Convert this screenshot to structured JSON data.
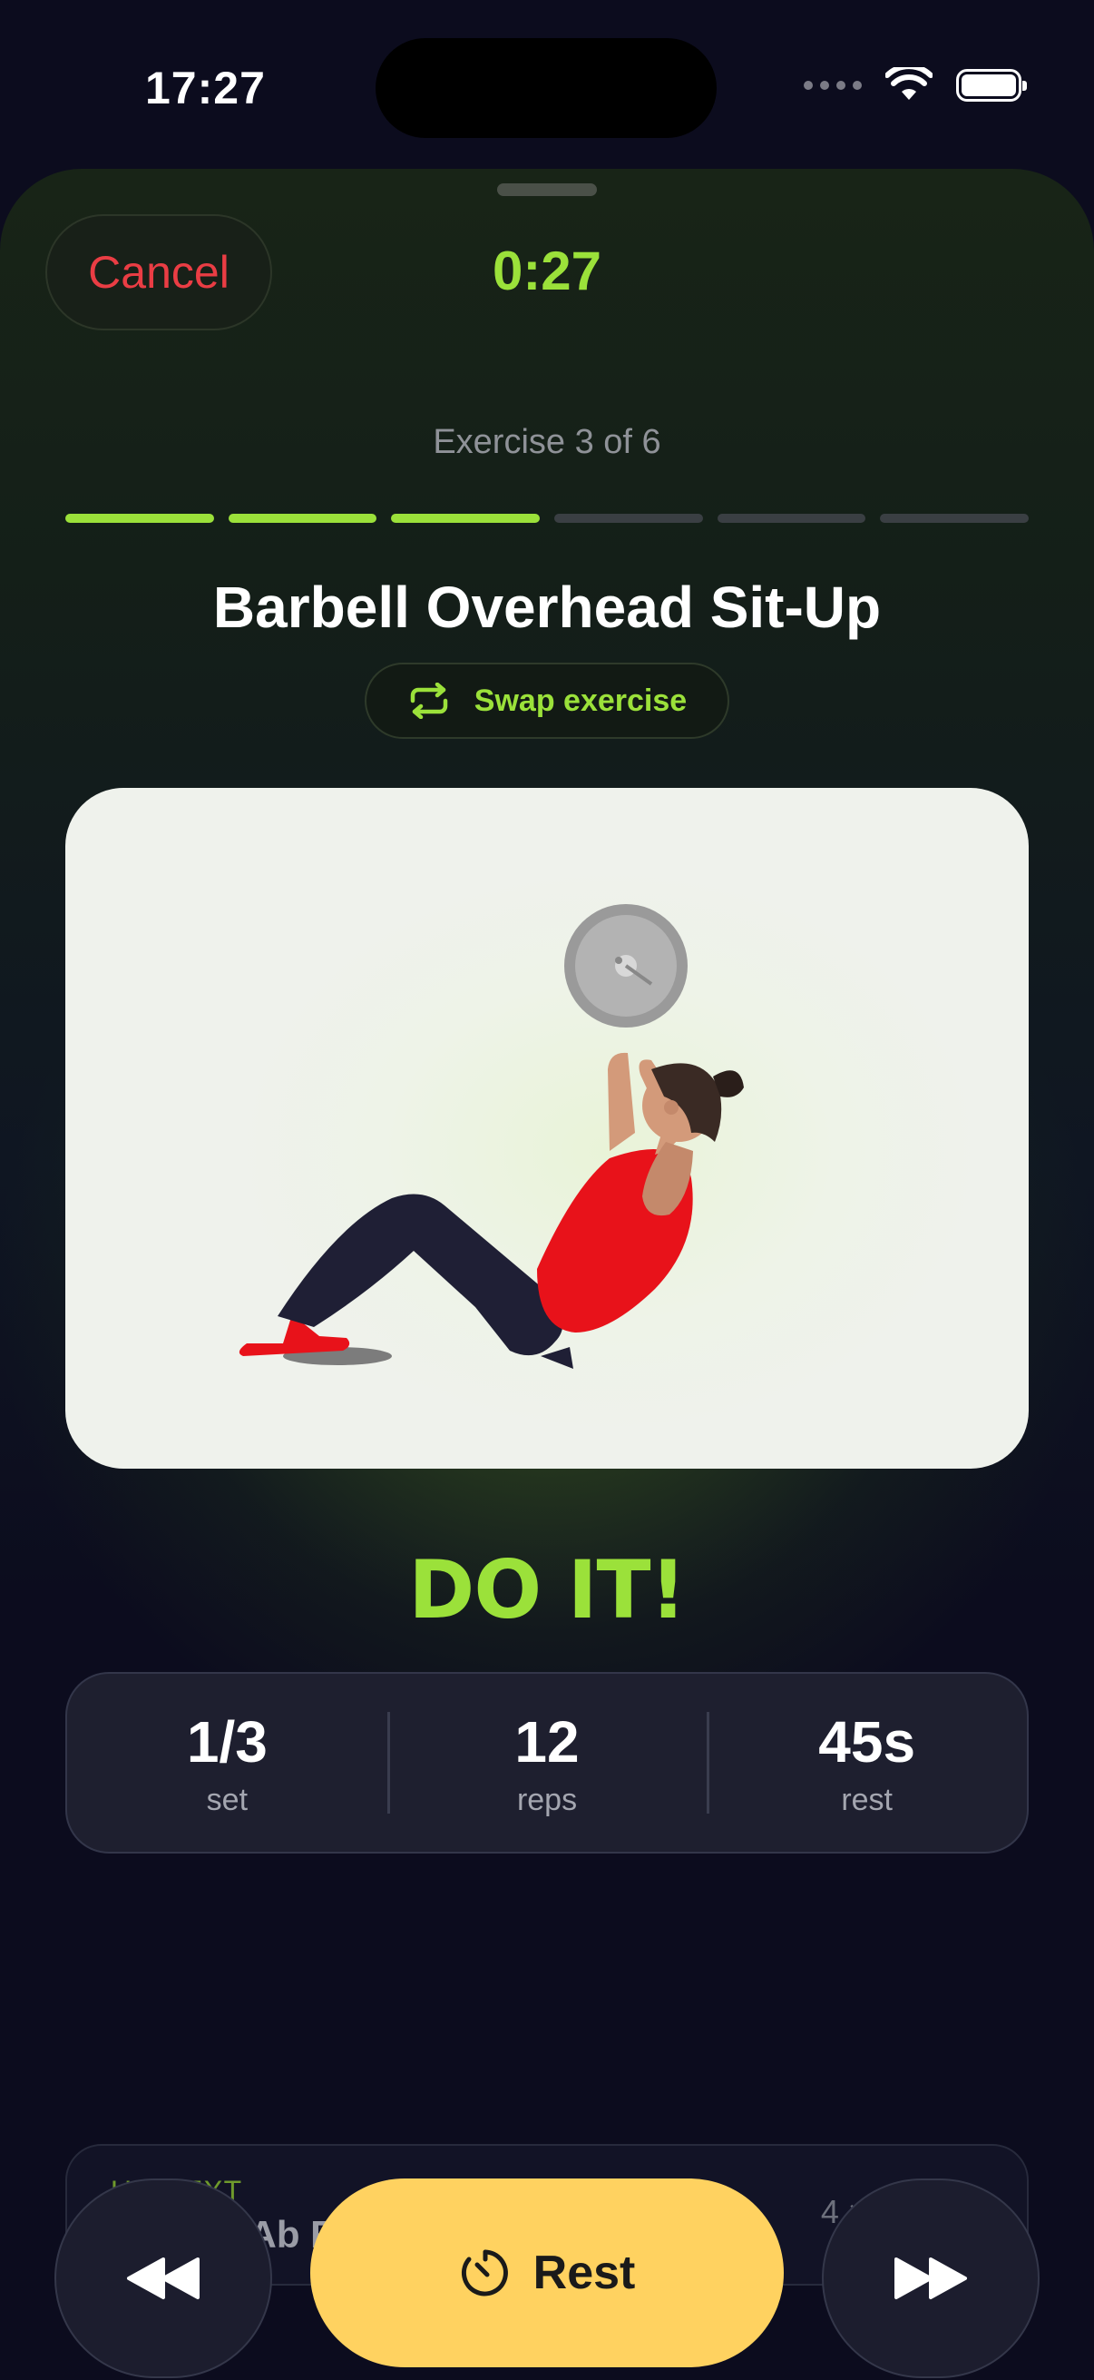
{
  "status_bar": {
    "time": "17:27"
  },
  "header": {
    "cancel_label": "Cancel",
    "timer": "0:27"
  },
  "progress": {
    "label": "Exercise 3 of 6",
    "current": 3,
    "total": 6
  },
  "exercise": {
    "name": "Barbell Overhead Sit-Up",
    "swap_label": "Swap exercise"
  },
  "cta": "DO IT!",
  "stats": [
    {
      "value": "1/3",
      "label": "set"
    },
    {
      "value": "12",
      "label": "reps"
    },
    {
      "value": "45s",
      "label": "rest"
    }
  ],
  "up_next": {
    "label": "UP NEXT",
    "title": "Barbell Ab Rollout",
    "meta": "4 × 15"
  },
  "controls": {
    "previous_icon": "rewind-icon",
    "rest_label": "Rest",
    "next_icon": "fast-forward-icon"
  },
  "colors": {
    "accent": "#9be13a",
    "cancel": "#ea3d44",
    "rest_button": "#ffd260",
    "background": "#0c0c1e"
  }
}
